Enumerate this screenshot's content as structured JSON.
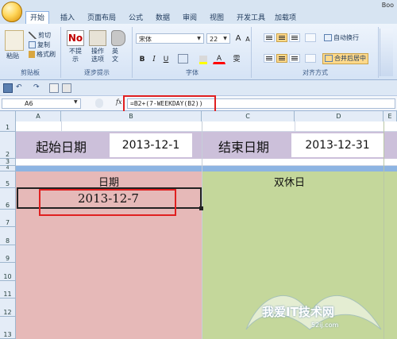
{
  "window": {
    "title": "Boo"
  },
  "tabs": [
    "开始",
    "插入",
    "页面布局",
    "公式",
    "数据",
    "审阅",
    "视图",
    "开发工具",
    "加载项"
  ],
  "ribbon": {
    "clipboard": {
      "paste": "粘贴",
      "cut": "剪切",
      "copy": "复制",
      "format_painter": "格式刷",
      "label": "剪贴板"
    },
    "hints": {
      "no_hint": "不提示",
      "options": "操作选项",
      "english": "英文",
      "label": "逐步提示"
    },
    "font": {
      "name": "宋体",
      "size": "22",
      "grow": "A",
      "shrink": "A",
      "bold": "B",
      "italic": "I",
      "underline": "U",
      "color_letter": "A",
      "wen": "雯",
      "label": "字体"
    },
    "alignment": {
      "wrap": "自动换行",
      "merge": "合并后居中",
      "label": "对齐方式"
    }
  },
  "formula_bar": {
    "name_box": "A6",
    "fx": "fx",
    "formula": "=B2+(7-WEEKDAY(B2))"
  },
  "columns": [
    "A",
    "B",
    "C",
    "D",
    "E"
  ],
  "rows": [
    "1",
    "2",
    "3",
    "4",
    "5",
    "6",
    "7",
    "8",
    "9",
    "10",
    "11",
    "12",
    "13"
  ],
  "sheet": {
    "start_label": "起始日期",
    "start_value": "2013-12-1",
    "end_label": "结束日期",
    "end_value": "2013-12-31",
    "date_header": "日期",
    "weekend_header": "双休日",
    "a6_value": "2013-12-7"
  },
  "colors": {
    "purple_band": "#ccc0da",
    "blue_divider": "#8db4e2",
    "red_column": "#e6b9b8",
    "green_column": "#c4d79b",
    "highlight": "#e02020"
  },
  "watermark": {
    "text": "我爱IT技术网",
    "url": "52ij.com"
  }
}
